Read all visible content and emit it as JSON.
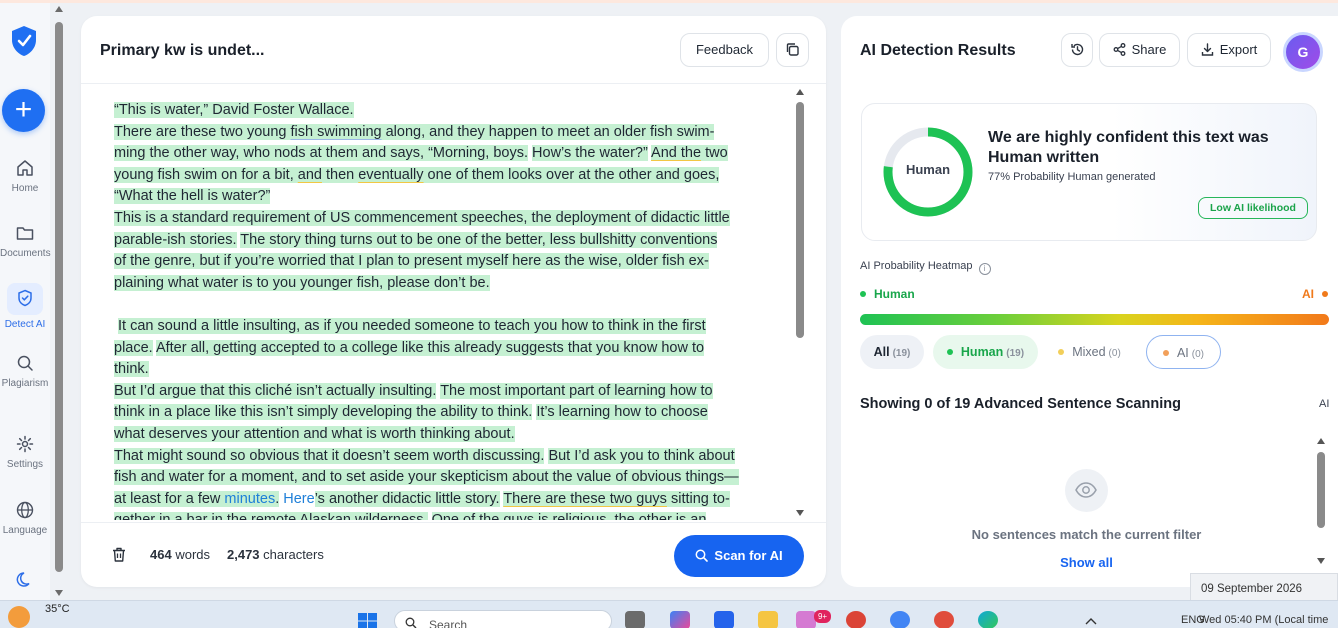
{
  "sidebar": {
    "items": [
      {
        "label": "Home"
      },
      {
        "label": "Documents"
      },
      {
        "label": "Detect AI"
      },
      {
        "label": "Plagiarism"
      },
      {
        "label": "Settings"
      },
      {
        "label": "Language"
      }
    ]
  },
  "editor": {
    "title": "Primary kw is undet...",
    "feedback_label": "Feedback",
    "paragraphs": [
      "“This is water,” David Foster Wallace.",
      "There are these two young fish swimming along, and they happen to meet an older fish swim-ming the other way, who nods at them and says, “Morning, boys. How’s the water?” And the two young fish swim on for a bit, and then eventually one of them looks over at the other and goes, “What the hell is water?”",
      "This is a standard requirement of US commencement speeches, the deployment of didactic little parable-ish stories. The story thing turns out to be one of the better, less bullshitty conventions of the genre, but if you’re worried that I plan to present myself here as the wise, older fish ex-plaining what water is to you younger fish, please don’t be.",
      "It can sound a little insulting, as if you needed someone to teach you how to think in the first place. After all, getting accepted to a college like this already suggests that you know how to think.",
      "But I’d argue that this cliché isn’t actually insulting. The most important part of learning how to think in a place like this isn’t simply developing the ability to think. It’s learning how to choose what deserves your attention and what is worth thinking about.",
      "That might sound so obvious that it doesn’t seem worth discussing. But I’d ask you to think about fish and water for a moment, and to set aside your skepticism about the value of obvious things—at least for a few minutes. Here’s another didactic little story. There are these two guys sitting to-gether in a bar in the remote Alaskan wilderness. One of the guys is religious, the other is an"
    ],
    "word_count": "464",
    "words_label": "words",
    "char_count": "2,473",
    "chars_label": "characters",
    "scan_label": "Scan for AI"
  },
  "results": {
    "title": "AI Detection Results",
    "share_label": "Share",
    "export_label": "Export",
    "avatar_initial": "G",
    "gauge_label": "Human",
    "human_probability": 0.77,
    "verdict": "We are highly confident this text was Human written",
    "verdict_sub": "77% Probability Human generated",
    "likelihood_badge": "Low AI likelihood",
    "heatmap_title": "AI Probability Heatmap",
    "heatmap_human": "Human",
    "heatmap_ai": "AI",
    "filters": [
      {
        "label": "All",
        "count": "(19)"
      },
      {
        "label": "Human",
        "count": "(19)"
      },
      {
        "label": "Mixed",
        "count": "(0)"
      },
      {
        "label": "AI",
        "count": "(0)"
      }
    ],
    "showing": "Showing 0 of 19 Advanced Sentence Scanning",
    "showing_ai": "AI",
    "empty_text": "No sentences match the current filter",
    "show_all": "Show all",
    "colors": {
      "human": "#1ec254",
      "ai": "#f07a1b",
      "accent": "#1764f0"
    }
  },
  "tooltip": {
    "date": "09 September 2026",
    "datetime": "Wed 05:40 PM (Local time"
  },
  "taskbar": {
    "temperature": "35°C",
    "search_placeholder": "Search",
    "badge": "9+",
    "lang": "ENG"
  }
}
